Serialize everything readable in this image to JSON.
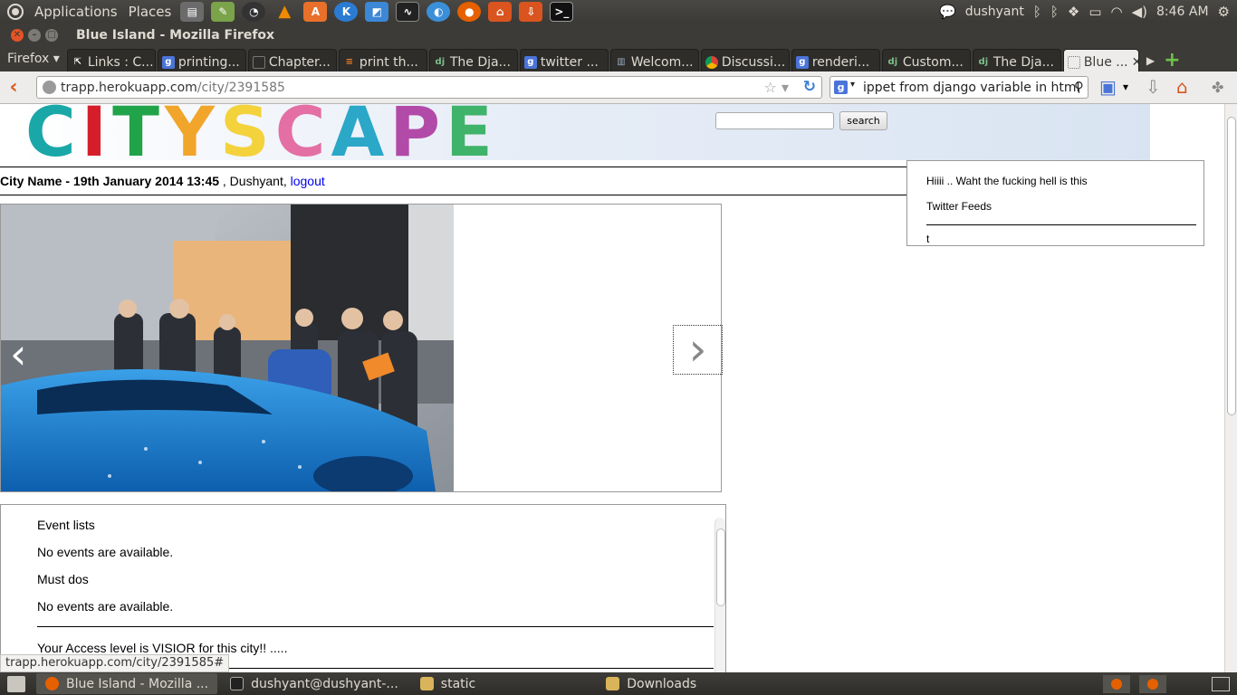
{
  "top_panel": {
    "applications": "Applications",
    "places": "Places",
    "user": "dushyant",
    "clock": "8:46 AM"
  },
  "window": {
    "title": "Blue Island - Mozilla Firefox"
  },
  "tabs": {
    "firefox_menu": "Firefox",
    "items": [
      {
        "label": "Links : C...",
        "icon": "links-icon"
      },
      {
        "label": "printing...",
        "icon": "google-icon"
      },
      {
        "label": "Chapter...",
        "icon": "page-icon"
      },
      {
        "label": "print th...",
        "icon": "stackoverflow-icon"
      },
      {
        "label": "The Dja...",
        "icon": "django-icon"
      },
      {
        "label": "twitter ...",
        "icon": "google-icon"
      },
      {
        "label": "Welcom...",
        "icon": "page-icon"
      },
      {
        "label": "Discussi...",
        "icon": "chrome-icon"
      },
      {
        "label": "renderi...",
        "icon": "google-icon"
      },
      {
        "label": "Custom...",
        "icon": "django-icon"
      },
      {
        "label": "The Dja...",
        "icon": "django-icon"
      }
    ],
    "active": "Blue ..."
  },
  "nav": {
    "url_host": "trapp.herokuapp.com",
    "url_path": "/city/2391585",
    "search_text": "ippet from  django variable in html"
  },
  "page": {
    "logo_letters": [
      "C",
      "I",
      "T",
      "Y",
      " ",
      "S",
      "C",
      "A",
      "P",
      "E"
    ],
    "search_button": "search",
    "city_name": "City Name - 19th January 2014 13:45",
    "user_sep": " , Dushyant, ",
    "logout": "logout",
    "sidebar": {
      "greeting": "Hiiii .. Waht the fucking hell is this",
      "feeds_title": "Twitter Feeds",
      "feed_item": "t"
    },
    "events": {
      "event_lists": "Event lists",
      "no_events_1": "No events are available.",
      "must_dos": "Must dos",
      "no_events_2": "No events are available.",
      "access_level": "Your Access level is VISIOR for this city!! ....."
    },
    "status_url": "trapp.herokuapp.com/city/2391585#"
  },
  "taskbar": {
    "items": [
      {
        "label": "Blue Island - Mozilla ...",
        "icon": "firefox-icon",
        "active": true
      },
      {
        "label": "dushyant@dushyant-...",
        "icon": "terminal-icon",
        "active": false
      },
      {
        "label": "static",
        "icon": "folder-icon",
        "active": false
      },
      {
        "label": "Downloads",
        "icon": "folder-icon",
        "active": false
      }
    ]
  },
  "colors": {
    "firefox_orange": "#e66000",
    "link_blue": "#0000ee",
    "panel_dark": "#3c3b37"
  }
}
